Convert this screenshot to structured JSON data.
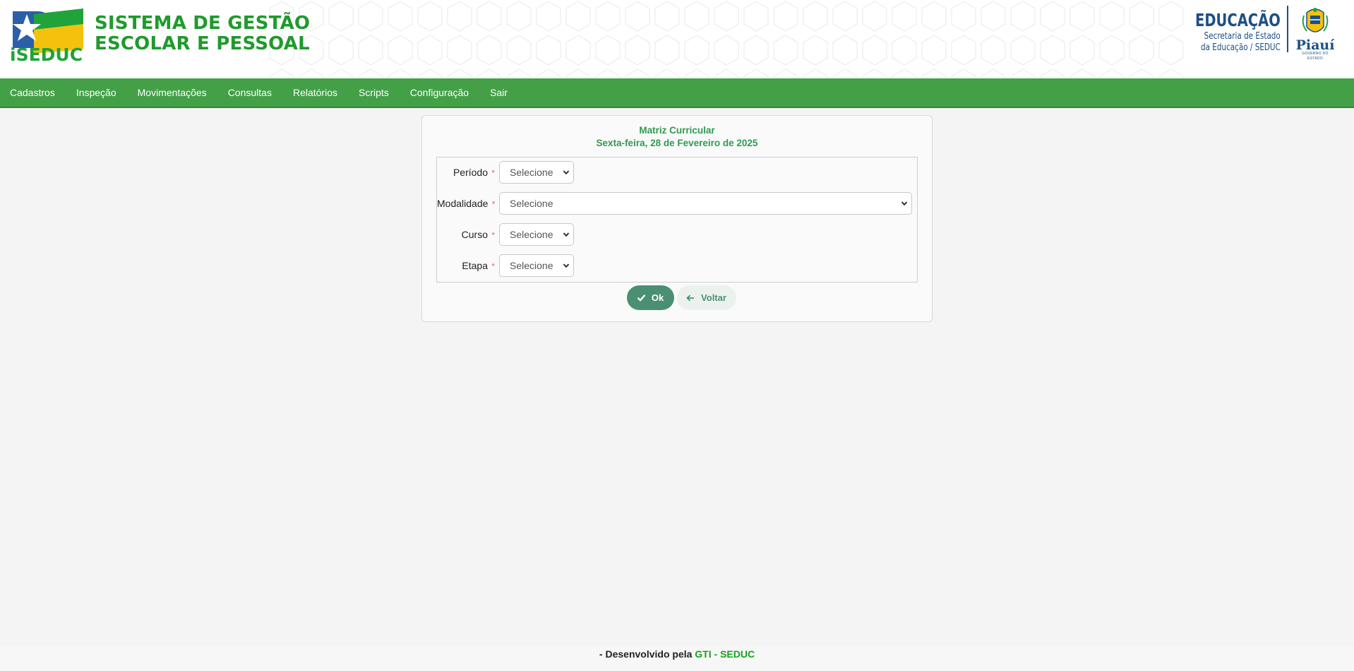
{
  "header": {
    "brand_logo_text": "iSEDUC",
    "title_line1": "SISTEMA DE GESTÃO",
    "title_line2": "ESCOLAR E PESSOAL",
    "seduc_title": "EDUCAÇÃO",
    "seduc_sub1": "Secretaria de Estado",
    "seduc_sub2": "da Educação / SEDUC",
    "state_name": "Piauí",
    "state_sub": "GOVERNO DO ESTADO"
  },
  "nav": {
    "items": [
      "Cadastros",
      "Inspeção",
      "Movimentações",
      "Consultas",
      "Relatórios",
      "Scripts",
      "Configuração",
      "Sair"
    ]
  },
  "card": {
    "title": "Matriz Curricular",
    "date": "Sexta-feira, 28 de Fevereiro de 2025"
  },
  "form": {
    "required_mark": "*",
    "fields": [
      {
        "label": "Período",
        "value": "Selecione"
      },
      {
        "label": "Modalidade",
        "value": "Selecione"
      },
      {
        "label": "Curso",
        "value": "Selecione"
      },
      {
        "label": "Etapa",
        "value": "Selecione"
      }
    ]
  },
  "buttons": {
    "ok_label": "Ok",
    "back_label": "Voltar"
  },
  "footer": {
    "prefix": "- Desenvolvido pela",
    "org": "GTI - SEDUC"
  },
  "colors": {
    "brand_green": "#1f9a2c",
    "nav_green": "#43a047",
    "card_title_green": "#2e9b4e",
    "ok_button": "#4b8f73",
    "seduc_blue": "#1c4f86"
  },
  "icons": {
    "ok": "check-icon",
    "back": "arrow-left-icon",
    "select": "chevron-down-icon"
  }
}
